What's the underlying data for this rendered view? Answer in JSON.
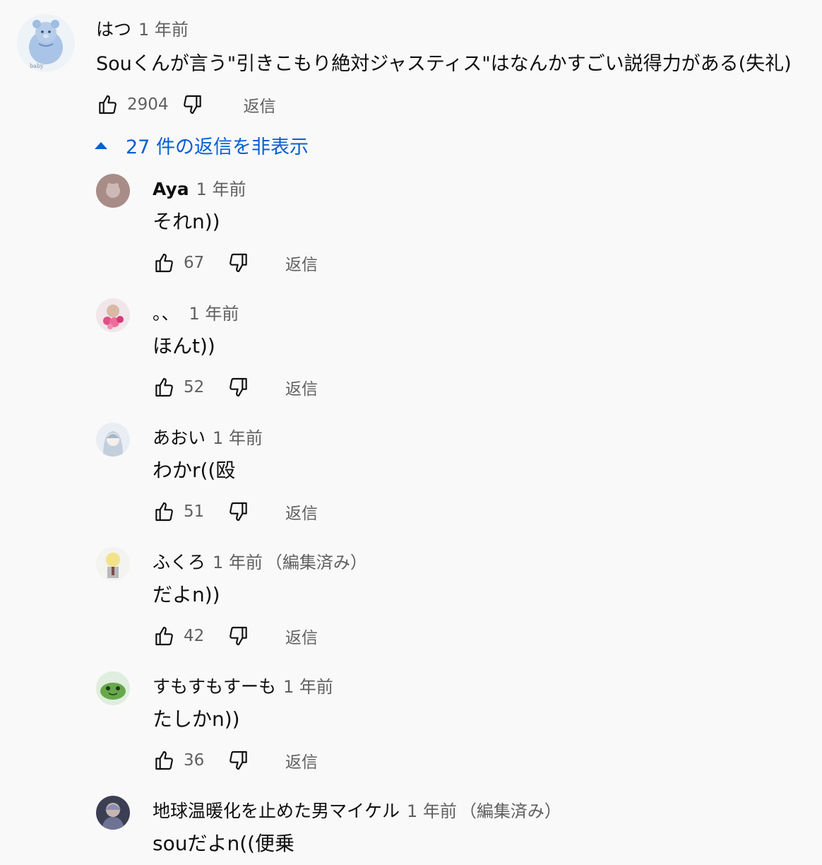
{
  "top_comment": {
    "author": "はつ",
    "time": "1 年前",
    "text": "Souくんが言う\"引きこもり絶対ジャスティス\"はなんかすごい説得力がある(失礼)",
    "likes": "2904",
    "reply_label": "返信",
    "avatar_text": "baby"
  },
  "replies_toggle": {
    "label": "27 件の返信を非表示"
  },
  "replies": [
    {
      "author": "Aya",
      "time": "1 年前",
      "edited": "",
      "text": "それn))",
      "likes": "67",
      "reply_label": "返信"
    },
    {
      "author": "。、",
      "time": "1 年前",
      "edited": "",
      "text": "ほんt))",
      "likes": "52",
      "reply_label": "返信"
    },
    {
      "author": "あおい",
      "time": "1 年前",
      "edited": "",
      "text": "わかr((殴",
      "likes": "51",
      "reply_label": "返信"
    },
    {
      "author": "ふくろ",
      "time": "1 年前",
      "edited": "（編集済み）",
      "text": "だよn))",
      "likes": "42",
      "reply_label": "返信"
    },
    {
      "author": "すもすもすーも",
      "time": "1 年前",
      "edited": "",
      "text": "たしかn))",
      "likes": "36",
      "reply_label": "返信"
    },
    {
      "author": "地球温暖化を止めた男マイケル",
      "time": "1 年前",
      "edited": "（編集済み）",
      "text": "souだよn((便乗",
      "likes": "",
      "reply_label": ""
    }
  ],
  "icons": {
    "like": "thumbs-up-icon",
    "dislike": "thumbs-down-icon",
    "toggle": "caret-up-icon"
  },
  "colors": {
    "background": "#f9f9f9",
    "link_blue": "#065fd4",
    "secondary_text": "#606060"
  }
}
